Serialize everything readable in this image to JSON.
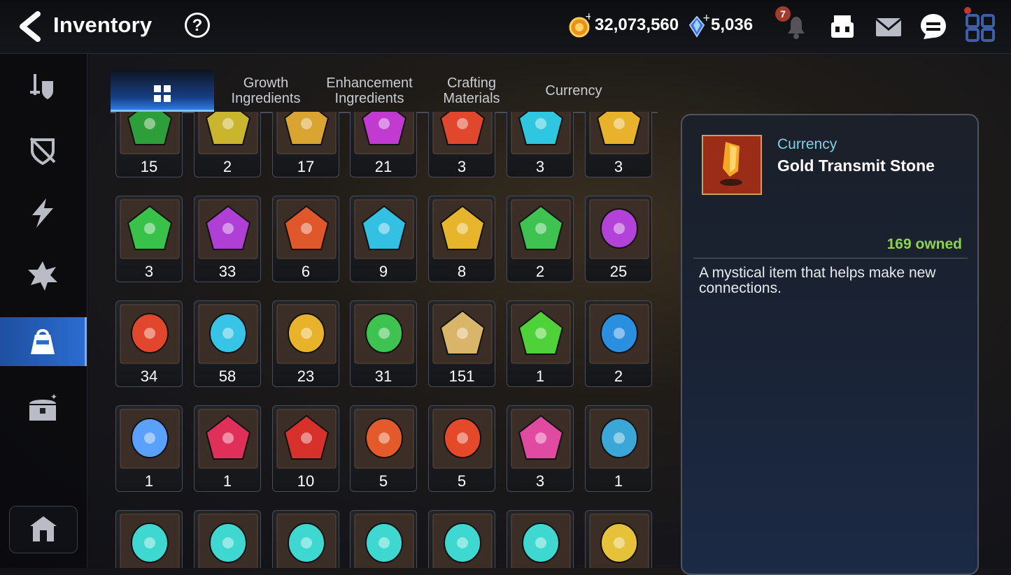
{
  "header": {
    "title": "Inventory",
    "help": "?",
    "gold": "32,073,560",
    "crystals": "5,036",
    "notification_count": "7"
  },
  "tabs": [
    {
      "line1": "",
      "line2": ""
    },
    {
      "line1": "Growth",
      "line2": "Ingredients"
    },
    {
      "line1": "Enhancement",
      "line2": "Ingredients"
    },
    {
      "line1": "Crafting",
      "line2": "Materials"
    },
    {
      "line1": "Currency",
      "line2": ""
    }
  ],
  "items": [
    {
      "qty": "15",
      "icon": "clover-icon",
      "color": "#2e9e3a"
    },
    {
      "qty": "2",
      "icon": "bird-portrait-icon",
      "color": "#c9b52e"
    },
    {
      "qty": "17",
      "icon": "gold-flower-icon",
      "color": "#d9a431"
    },
    {
      "qty": "21",
      "icon": "purple-rune-crest-icon",
      "color": "#c23bd1"
    },
    {
      "qty": "3",
      "icon": "red-rune-crest-icon",
      "color": "#e0472c"
    },
    {
      "qty": "3",
      "icon": "blue-rune-crest-icon",
      "color": "#2fc6e0"
    },
    {
      "qty": "3",
      "icon": "yellow-rune-crest-icon",
      "color": "#e8b22a"
    },
    {
      "qty": "3",
      "icon": "green-rune-crest-icon",
      "color": "#38c24a"
    },
    {
      "qty": "33",
      "icon": "purple-rune-shard-icon",
      "color": "#b03fd6"
    },
    {
      "qty": "6",
      "icon": "red-rune-shard-icon",
      "color": "#e0572c"
    },
    {
      "qty": "9",
      "icon": "blue-rune-shard-icon",
      "color": "#33c0e3"
    },
    {
      "qty": "8",
      "icon": "yellow-rune-shard-icon",
      "color": "#e6b52b"
    },
    {
      "qty": "2",
      "icon": "green-rune-shard-icon",
      "color": "#3ec250"
    },
    {
      "qty": "25",
      "icon": "purple-rune-stone-icon",
      "color": "#b342d8"
    },
    {
      "qty": "34",
      "icon": "red-rune-stone-icon",
      "color": "#e0472c"
    },
    {
      "qty": "58",
      "icon": "blue-rune-stone-icon",
      "color": "#37c4e6"
    },
    {
      "qty": "23",
      "icon": "yellow-rune-stone-icon",
      "color": "#e8b22a"
    },
    {
      "qty": "31",
      "icon": "green-rune-stone-icon",
      "color": "#3ec250"
    },
    {
      "qty": "151",
      "icon": "ginseng-root-icon",
      "color": "#d9b56a"
    },
    {
      "qty": "1",
      "icon": "green-potion-bowl-icon",
      "color": "#4fd13a"
    },
    {
      "qty": "2",
      "icon": "blue-sigil-orb-icon",
      "color": "#2b8fe0"
    },
    {
      "qty": "1",
      "icon": "blue-crystal-orb-icon",
      "color": "#5aa0ff"
    },
    {
      "qty": "1",
      "icon": "red-star-gem-icon",
      "color": "#e0305a"
    },
    {
      "qty": "10",
      "icon": "red-hex-star-icon",
      "color": "#d8302a"
    },
    {
      "qty": "5",
      "icon": "red-hammer-stone-icon",
      "color": "#e45a2a"
    },
    {
      "qty": "5",
      "icon": "red-sword-stone-icon",
      "color": "#e44a2a"
    },
    {
      "qty": "3",
      "icon": "pink-potion-icon",
      "color": "#e04aa0"
    },
    {
      "qty": "1",
      "icon": "blue-hammer-stone-icon",
      "color": "#3aa7d8"
    },
    {
      "qty": "",
      "icon": "teal-sword-stone-icon",
      "color": "#3fd8d0"
    },
    {
      "qty": "",
      "icon": "teal-swirl-stone-icon",
      "color": "#3fd8d0"
    },
    {
      "qty": "",
      "icon": "teal-glove-stone-icon",
      "color": "#3fd8d0"
    },
    {
      "qty": "",
      "icon": "teal-boot-stone-icon",
      "color": "#3fd8d0"
    },
    {
      "qty": "",
      "icon": "teal-staff-stone-icon",
      "color": "#3fd8d0"
    },
    {
      "qty": "",
      "icon": "teal-star-stone-icon",
      "color": "#3fd8d0"
    },
    {
      "qty": "",
      "icon": "gold-hammer-stone-icon",
      "color": "#e6c23a"
    }
  ],
  "detail": {
    "category": "Currency",
    "name": "Gold Transmit Stone",
    "owned": "169 owned",
    "description": "A mystical item that helps make new connections.",
    "icon": "gold-transmit-stone-icon"
  }
}
